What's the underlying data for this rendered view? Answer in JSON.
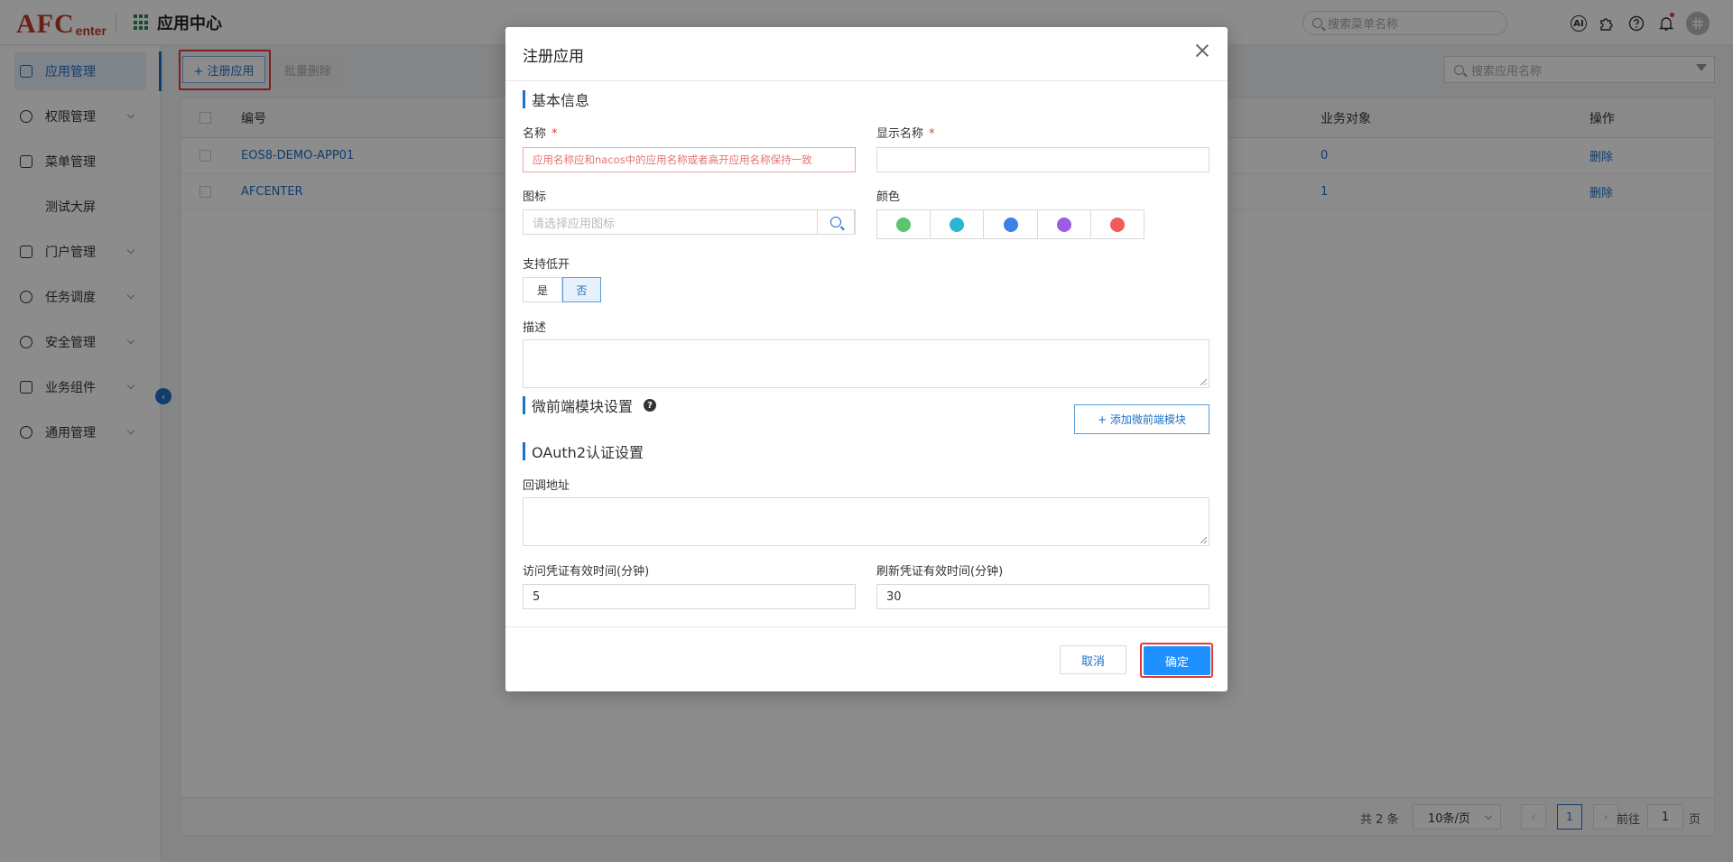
{
  "logo": {
    "main": "AFC",
    "sub": "enter"
  },
  "app_center": {
    "title": "应用中心"
  },
  "top_search": {
    "placeholder": "搜索菜单名称"
  },
  "top_icons": {
    "ai": "AI"
  },
  "sidebar": {
    "items": [
      {
        "label": "应用管理",
        "icon": "apps-icon",
        "active": true
      },
      {
        "label": "权限管理",
        "icon": "user-icon"
      },
      {
        "label": "菜单管理",
        "icon": "menu-icon"
      },
      {
        "label": "测试大屏",
        "icon": ""
      },
      {
        "label": "门户管理",
        "icon": "portal-icon"
      },
      {
        "label": "任务调度",
        "icon": "task-icon"
      },
      {
        "label": "安全管理",
        "icon": "shield-icon"
      },
      {
        "label": "业务组件",
        "icon": "component-icon"
      },
      {
        "label": "通用管理",
        "icon": "settings-icon"
      }
    ]
  },
  "toolbar": {
    "register_label": "+ 注册应用",
    "batch_delete_label": "批量删除",
    "search_placeholder": "搜索应用名称"
  },
  "table": {
    "columns": {
      "code": "编号",
      "biz_object": "业务对象",
      "action": "操作"
    },
    "rows": [
      {
        "code": "EOS8-DEMO-APP01",
        "biz_object": "0",
        "action": "删除"
      },
      {
        "code": "AFCENTER",
        "biz_object": "1",
        "action": "删除"
      }
    ]
  },
  "pagination": {
    "total": "共 2 条",
    "page_size": "10条/页",
    "current": "1",
    "goto_label": "前往",
    "goto_value": "1",
    "page_unit": "页"
  },
  "modal": {
    "title": "注册应用",
    "basic_section": "基本信息",
    "name_label": "名称",
    "name_placeholder": "应用名称应和nacos中的应用名称或者高开应用名称保持一致",
    "display_name_label": "显示名称",
    "display_name_value": "",
    "required_mark": "*",
    "icon_label": "图标",
    "icon_placeholder": "请选择应用图标",
    "color_label": "颜色",
    "colors": [
      "#5cc36e",
      "#2bb4d4",
      "#3b82e6",
      "#9b5de5",
      "#ef5b5b"
    ],
    "lowcode_label": "支持低开",
    "lowcode_yes": "是",
    "lowcode_no": "否",
    "desc_label": "描述",
    "micro_section": "微前端模块设置",
    "help_mark": "?",
    "add_micro_label": "+ 添加微前端模块",
    "oauth_section": "OAuth2认证设置",
    "callback_label": "回调地址",
    "access_label": "访问凭证有效时间(分钟)",
    "access_value": "5",
    "refresh_label": "刷新凭证有效时间(分钟)",
    "refresh_value": "30",
    "cancel_label": "取消",
    "ok_label": "确定"
  }
}
